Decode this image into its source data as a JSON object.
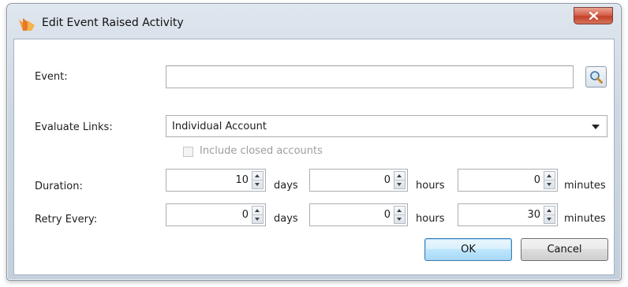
{
  "window": {
    "title": "Edit Event Raised Activity"
  },
  "form": {
    "event": {
      "label": "Event:",
      "value": ""
    },
    "evaluate_links": {
      "label": "Evaluate Links:",
      "selected": "Individual Account"
    },
    "include_closed": {
      "label": "Include closed accounts",
      "checked": false,
      "enabled": false
    },
    "duration": {
      "label": "Duration:",
      "days": "10",
      "days_unit": "days",
      "hours": "0",
      "hours_unit": "hours",
      "minutes": "0",
      "minutes_unit": "minutes"
    },
    "retry": {
      "label": "Retry Every:",
      "days": "0",
      "days_unit": "days",
      "hours": "0",
      "hours_unit": "hours",
      "minutes": "30",
      "minutes_unit": "minutes"
    }
  },
  "buttons": {
    "ok": "OK",
    "cancel": "Cancel"
  },
  "icons": {
    "app": "activity-flame-icon",
    "close": "close-icon",
    "lookup": "magnifier-icon"
  },
  "colors": {
    "close_button": "#c4402a",
    "default_button_border": "#3c7fb1"
  }
}
